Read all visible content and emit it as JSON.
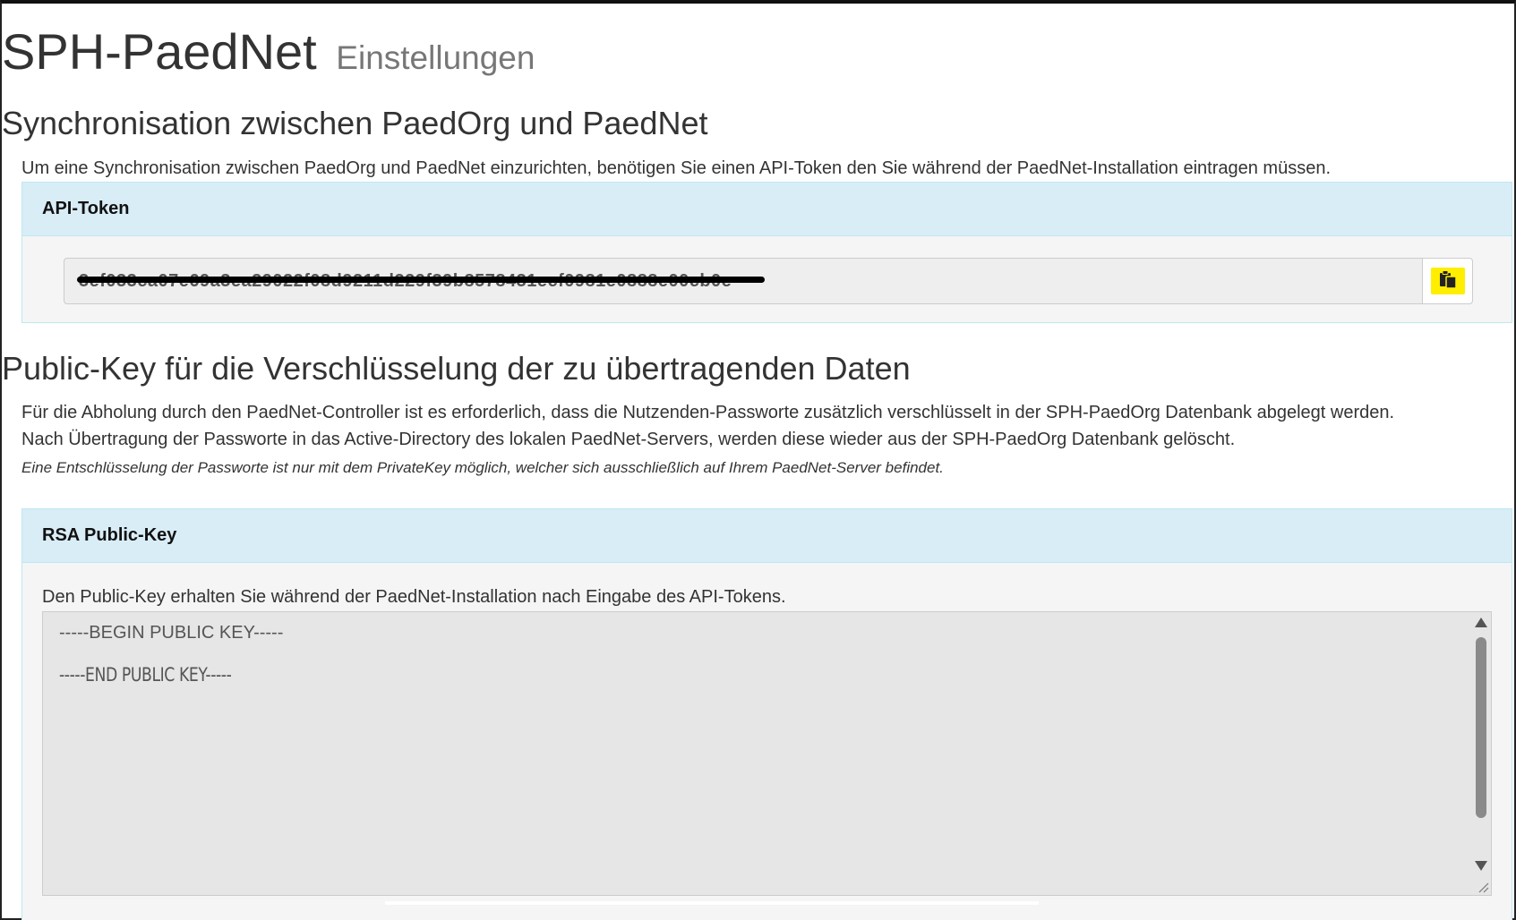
{
  "header": {
    "title": "SPH-PaedNet",
    "subtitle": "Einstellungen"
  },
  "sync": {
    "heading": "Synchronisation zwischen PaedOrg und PaedNet",
    "intro": "Um eine Synchronisation zwischen PaedOrg und PaedNet einzurichten, benötigen Sie einen API-Token den Sie während der PaedNet-Installation eintragen müssen.",
    "panel_title": "API-Token",
    "token_value": "3ef033ca07e69a3ea29022f08d9211d229f39b8578431ecf0981e0888e00cb0e",
    "copy_icon": "clipboard-icon",
    "highlight_color": "#ffee00"
  },
  "public_key": {
    "heading": "Public-Key für die Verschlüsselung der zu übertragenden Daten",
    "desc_line_1": "Für die Abholung durch den PaedNet-Controller ist es erforderlich, dass die Nutzenden-Passworte zusätzlich verschlüsselt in der SPH-PaedOrg Datenbank abgelegt werden.",
    "desc_line_2": "Nach Übertragung der Passworte in das Active-Directory des lokalen PaedNet-Servers, werden diese wieder aus der SPH-PaedOrg Datenbank gelöscht.",
    "note": "Eine Entschlüsselung der Passworte ist nur mit dem PrivateKey möglich, welcher sich ausschließlich auf Ihrem PaedNet-Server befindet.",
    "panel_title": "RSA Public-Key",
    "panel_desc": "Den Public-Key erhalten Sie während der PaedNet-Installation nach Eingabe des API-Tokens.",
    "key_begin": "-----BEGIN PUBLIC KEY-----",
    "key_end": "-----END PUBLIC KEY-----"
  },
  "colors": {
    "panel_heading_bg": "#d9edf7",
    "panel_border": "#bce8f1",
    "panel_body_bg": "#f5f5f5"
  }
}
